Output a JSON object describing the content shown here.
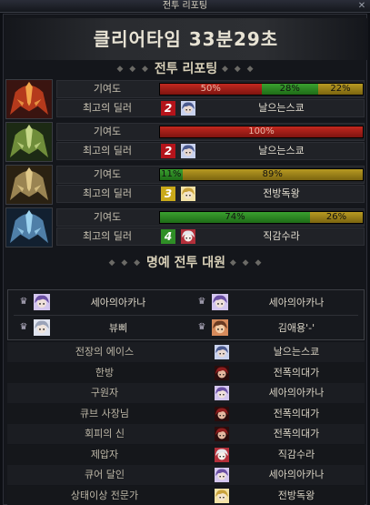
{
  "window": {
    "title": "전투 리포팅",
    "close_icon": "close-icon"
  },
  "clear_time": "클리어타임  33분29초",
  "sections": {
    "report": "전투 리포팅",
    "honor": "명예 전투 대원"
  },
  "row_labels": {
    "contribution": "기여도",
    "top_dealer": "최고의 딜러"
  },
  "bosses": [
    {
      "icon": "red-boss-helm-icon",
      "contribution": [
        {
          "label": "50%",
          "value": 50,
          "color": "red"
        },
        {
          "label": "28%",
          "value": 28,
          "color": "green"
        },
        {
          "label": "22%",
          "value": 22,
          "color": "yellow"
        }
      ],
      "top_dealer": {
        "rank": "2",
        "rank_color": "red",
        "name": "날으는스쿄",
        "portrait": "blue-hair"
      }
    },
    {
      "icon": "green-boss-helm-icon",
      "contribution": [
        {
          "label": "100%",
          "value": 100,
          "color": "red"
        }
      ],
      "top_dealer": {
        "rank": "2",
        "rank_color": "red",
        "name": "날으는스쿄",
        "portrait": "blue-hair"
      }
    },
    {
      "icon": "gold-boss-helm-icon",
      "contribution": [
        {
          "label": "11%",
          "value": 11,
          "color": "green"
        },
        {
          "label": "89%",
          "value": 89,
          "color": "yellow"
        }
      ],
      "top_dealer": {
        "rank": "3",
        "rank_color": "yellow",
        "name": "전방독왕",
        "portrait": "blonde"
      }
    },
    {
      "icon": "blue-boss-helm-icon",
      "contribution": [
        {
          "label": "74%",
          "value": 74,
          "color": "green"
        },
        {
          "label": "26%",
          "value": 26,
          "color": "yellow"
        }
      ],
      "top_dealer": {
        "rank": "4",
        "rank_color": "green",
        "name": "직감수라",
        "portrait": "white-hair"
      }
    }
  ],
  "honor_members": [
    {
      "name": "세아의아카나",
      "portrait": "purple-hair"
    },
    {
      "name": "세아의아카나",
      "portrait": "purple-hair"
    },
    {
      "name": "뷰삐",
      "portrait": "silver-hair"
    },
    {
      "name": "김애용'-'",
      "portrait": "brown-hair"
    }
  ],
  "awards": [
    {
      "title": "전장의 에이스",
      "name": "날으는스쿄",
      "portrait": "blue-hair"
    },
    {
      "title": "한방",
      "name": "전폭의대가",
      "portrait": "red-hair"
    },
    {
      "title": "구원자",
      "name": "세아의아카나",
      "portrait": "purple-hair"
    },
    {
      "title": "큐브 사장님",
      "name": "전폭의대가",
      "portrait": "red-hair"
    },
    {
      "title": "회피의 신",
      "name": "전폭의대가",
      "portrait": "red-hair"
    },
    {
      "title": "제압자",
      "name": "직감수라",
      "portrait": "white-hair"
    },
    {
      "title": "큐어 달인",
      "name": "세아의아카나",
      "portrait": "purple-hair"
    },
    {
      "title": "상태이상 전문가",
      "name": "전방독왕",
      "portrait": "blonde"
    }
  ],
  "colors": {
    "red": "#b3231b",
    "green": "#2f8f26",
    "yellow": "#a88b1c",
    "panel": "#14161b"
  }
}
